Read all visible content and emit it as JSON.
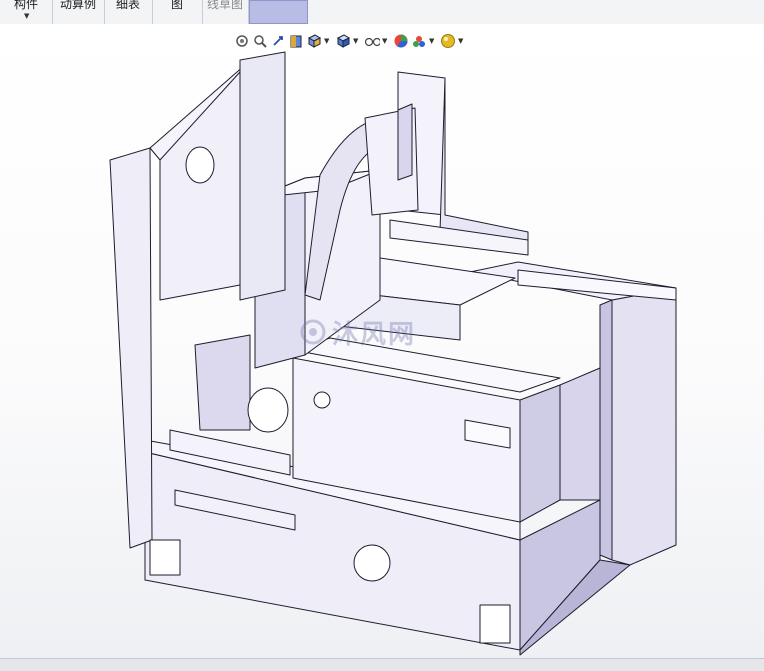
{
  "ribbon": {
    "tabs": [
      {
        "label": "构件"
      },
      {
        "label": "动算例"
      },
      {
        "label": "细表"
      },
      {
        "label": "图"
      },
      {
        "label": "线草图"
      },
      {
        "label": ""
      }
    ]
  },
  "headsup_toolbar": {
    "tools": [
      {
        "icon": "zoom-fit-icon"
      },
      {
        "icon": "zoom-area-icon"
      },
      {
        "icon": "previous-view-icon"
      },
      {
        "icon": "section-view-icon"
      },
      {
        "icon": "view-orientation-icon"
      },
      {
        "icon": "display-style-icon"
      },
      {
        "icon": "hide-show-items-icon"
      },
      {
        "icon": "edit-appearance-icon"
      },
      {
        "icon": "apply-scene-icon"
      },
      {
        "icon": "view-settings-icon"
      }
    ]
  },
  "watermark": {
    "text": "沐风网"
  },
  "colors": {
    "model_face": "#ecebf7",
    "model_shadow": "#b8b5d6",
    "model_edge": "#1d1d2e",
    "ribbon_bg": "#f3f4f6",
    "active_tab": "#b9bde6"
  }
}
